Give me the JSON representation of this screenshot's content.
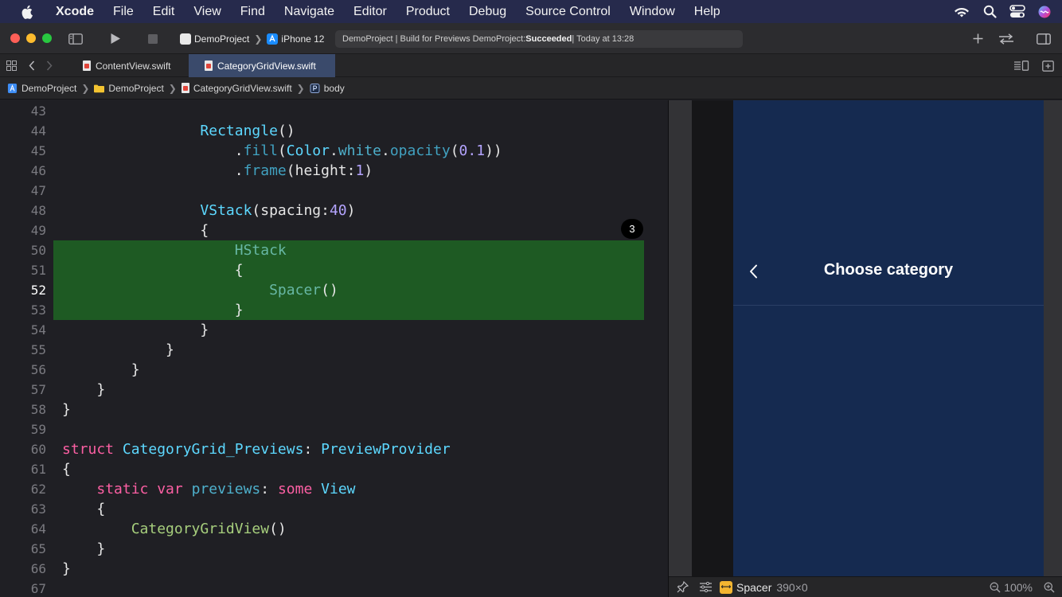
{
  "menubar": {
    "app": "Xcode",
    "items": [
      "File",
      "Edit",
      "View",
      "Find",
      "Navigate",
      "Editor",
      "Product",
      "Debug",
      "Source Control",
      "Window",
      "Help"
    ]
  },
  "toolbar": {
    "scheme": "DemoProject",
    "device": "iPhone 12",
    "activity_prefix": "DemoProject | Build for Previews DemoProject: ",
    "activity_status": "Succeeded",
    "activity_suffix": " | Today at 13:28"
  },
  "tabs": [
    {
      "label": "ContentView.swift",
      "active": false
    },
    {
      "label": "CategoryGridView.swift",
      "active": true
    }
  ],
  "jumpbar": [
    "DemoProject",
    "DemoProject",
    "CategoryGridView.swift",
    "body"
  ],
  "editor": {
    "current_line": 52,
    "change_badge": "3",
    "lines": [
      {
        "n": "43",
        "tokens": []
      },
      {
        "n": "44",
        "tokens": [
          [
            "                ",
            "plain"
          ],
          [
            "Rectangle",
            "type"
          ],
          [
            "()",
            "plain"
          ]
        ]
      },
      {
        "n": "45",
        "tokens": [
          [
            "                    .",
            "plain"
          ],
          [
            "fill",
            "method"
          ],
          [
            "(",
            "plain"
          ],
          [
            "Color",
            "type"
          ],
          [
            ".",
            "plain"
          ],
          [
            "white",
            "prop"
          ],
          [
            ".",
            "plain"
          ],
          [
            "opacity",
            "method"
          ],
          [
            "(",
            "plain"
          ],
          [
            "0.1",
            "number"
          ],
          [
            "))",
            "plain"
          ]
        ]
      },
      {
        "n": "46",
        "tokens": [
          [
            "                    .",
            "plain"
          ],
          [
            "frame",
            "method"
          ],
          [
            "(height:",
            "plain"
          ],
          [
            "1",
            "number"
          ],
          [
            ")",
            "plain"
          ]
        ]
      },
      {
        "n": "47",
        "tokens": []
      },
      {
        "n": "48",
        "tokens": [
          [
            "                ",
            "plain"
          ],
          [
            "VStack",
            "type"
          ],
          [
            "(spacing:",
            "plain"
          ],
          [
            "40",
            "number"
          ],
          [
            ")",
            "plain"
          ]
        ]
      },
      {
        "n": "49",
        "tokens": [
          [
            "                {",
            "plain"
          ]
        ]
      },
      {
        "n": "50",
        "tokens": [
          [
            "                    ",
            "plain"
          ],
          [
            "HStack",
            "green"
          ]
        ]
      },
      {
        "n": "51",
        "tokens": [
          [
            "                    {",
            "plain"
          ]
        ]
      },
      {
        "n": "52",
        "tokens": [
          [
            "                        ",
            "plain"
          ],
          [
            "Spacer",
            "green"
          ],
          [
            "()",
            "plain"
          ]
        ]
      },
      {
        "n": "53",
        "tokens": [
          [
            "                    }",
            "plain"
          ]
        ]
      },
      {
        "n": "54",
        "tokens": [
          [
            "                }",
            "plain"
          ]
        ]
      },
      {
        "n": "55",
        "tokens": [
          [
            "            }",
            "plain"
          ]
        ]
      },
      {
        "n": "56",
        "tokens": [
          [
            "        }",
            "plain"
          ]
        ]
      },
      {
        "n": "57",
        "tokens": [
          [
            "    }",
            "plain"
          ]
        ]
      },
      {
        "n": "58",
        "tokens": [
          [
            "}",
            "plain"
          ]
        ]
      },
      {
        "n": "59",
        "tokens": []
      },
      {
        "n": "60",
        "tokens": [
          [
            "struct ",
            "kw"
          ],
          [
            "CategoryGrid_Previews",
            "type"
          ],
          [
            ": ",
            "plain"
          ],
          [
            "PreviewProvider",
            "type"
          ]
        ]
      },
      {
        "n": "61",
        "tokens": [
          [
            "{",
            "plain"
          ]
        ]
      },
      {
        "n": "62",
        "tokens": [
          [
            "    ",
            "plain"
          ],
          [
            "static ",
            "kw"
          ],
          [
            "var ",
            "kw"
          ],
          [
            "previews",
            "prop"
          ],
          [
            ": ",
            "plain"
          ],
          [
            "some ",
            "kw"
          ],
          [
            "View",
            "type"
          ]
        ]
      },
      {
        "n": "63",
        "tokens": [
          [
            "    {",
            "plain"
          ]
        ]
      },
      {
        "n": "64",
        "tokens": [
          [
            "        ",
            "plain"
          ],
          [
            "CategoryGridView",
            "func"
          ],
          [
            "()",
            "plain"
          ]
        ]
      },
      {
        "n": "65",
        "tokens": [
          [
            "    }",
            "plain"
          ]
        ]
      },
      {
        "n": "66",
        "tokens": [
          [
            "}",
            "plain"
          ]
        ]
      },
      {
        "n": "67",
        "tokens": []
      }
    ]
  },
  "preview": {
    "nav_title": "Choose category"
  },
  "canvas_bar": {
    "element": "Spacer",
    "size": "390×0",
    "zoom": "100%"
  }
}
